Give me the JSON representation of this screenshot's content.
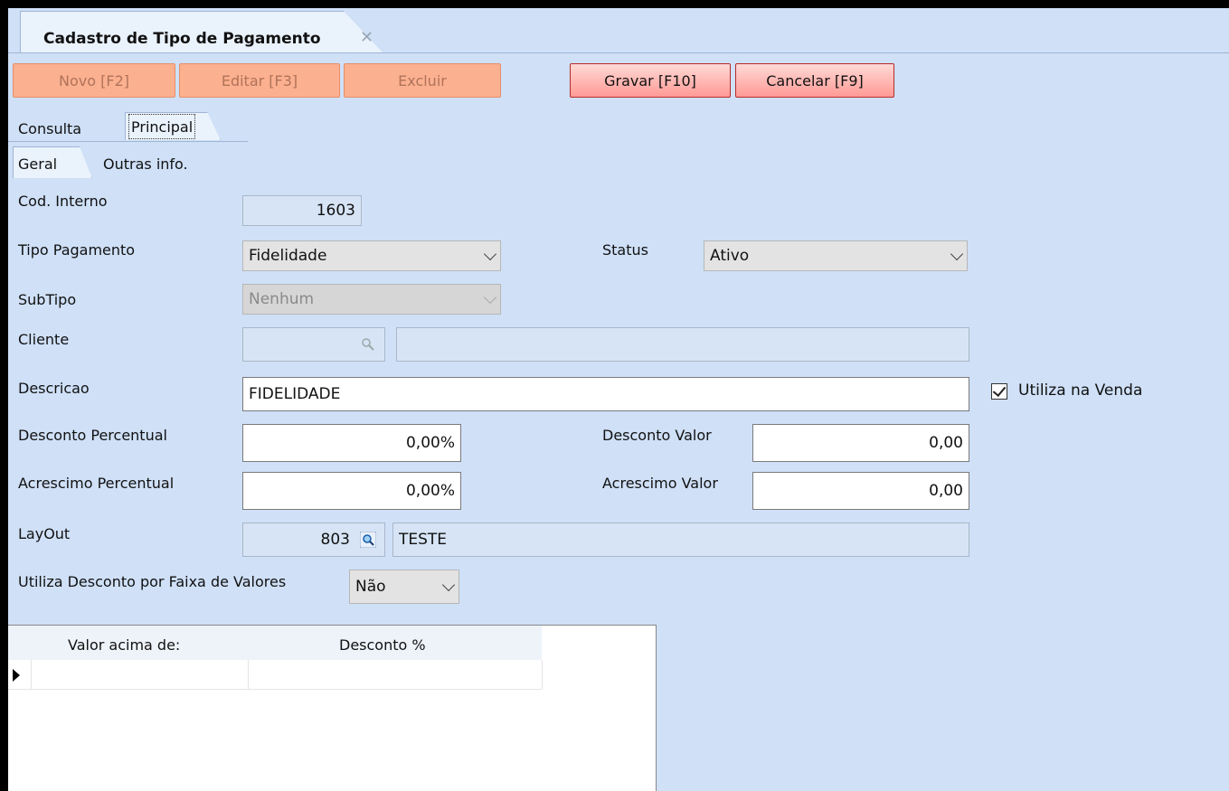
{
  "document_tab": {
    "title": "Cadastro de Tipo de Pagamento",
    "close_glyph": "✕"
  },
  "toolbar": {
    "novo": "Novo [F2]",
    "editar": "Editar [F3]",
    "excluir": "Excluir",
    "gravar": "Gravar [F10]",
    "cancelar": "Cancelar [F9]"
  },
  "tabs": {
    "consulta": "Consulta",
    "principal": "Principal"
  },
  "subtabs": {
    "geral": "Geral",
    "outras": "Outras info."
  },
  "form": {
    "cod_interno": {
      "label": "Cod. Interno",
      "value": "1603"
    },
    "tipo_pagamento": {
      "label": "Tipo  Pagamento",
      "value": "Fidelidade"
    },
    "status": {
      "label": "Status",
      "value": "Ativo"
    },
    "subtipo": {
      "label": "SubTipo",
      "value": "Nenhum"
    },
    "cliente": {
      "label": "Cliente",
      "code": "",
      "name": ""
    },
    "descricao": {
      "label": "Descricao",
      "value": "FIDELIDADE"
    },
    "utiliza_venda": {
      "label": "Utiliza na Venda",
      "checked": true
    },
    "desconto_percentual": {
      "label": "Desconto Percentual",
      "value": "0,00%"
    },
    "desconto_valor": {
      "label": "Desconto Valor",
      "value": "0,00"
    },
    "acrescimo_percentual": {
      "label": "Acrescimo Percentual",
      "value": "0,00%"
    },
    "acrescimo_valor": {
      "label": "Acrescimo Valor",
      "value": "0,00"
    },
    "layout": {
      "label": "LayOut",
      "code": "803",
      "name": "TESTE"
    },
    "faixa_valores": {
      "label": "Utiliza Desconto por Faixa de Valores",
      "value": "Não"
    }
  },
  "grid": {
    "columns": [
      "Valor acima de:",
      "Desconto %"
    ],
    "rows": [
      [
        "",
        ""
      ]
    ]
  },
  "icons": {
    "magnifier": "magnifier-icon",
    "dropdown": "chevron-down-icon",
    "close": "close-icon",
    "row_indicator": "row-indicator-icon"
  },
  "colors": {
    "background": "#cfe0f7",
    "button_active": "#ff9a95",
    "button_disabled": "#fbb08f"
  }
}
